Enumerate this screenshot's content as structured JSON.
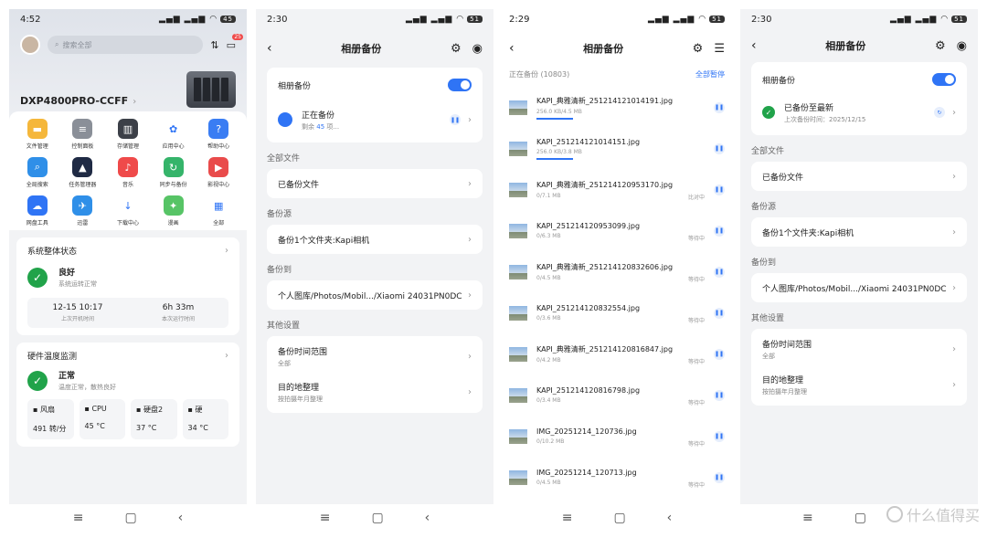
{
  "p1": {
    "time": "4:52",
    "battery": "45",
    "search_placeholder": "搜索全部",
    "badge": "25",
    "device": "DXP4800PRO-CCFF",
    "apps": [
      {
        "label": "文件管理",
        "color": "#f5b73b",
        "glyph": "▬"
      },
      {
        "label": "控制面板",
        "color": "#8a8f98",
        "glyph": "≡"
      },
      {
        "label": "存储管理",
        "color": "#3c4048",
        "glyph": "▥"
      },
      {
        "label": "应用中心",
        "color": "#ffffff",
        "glyph": "✿"
      },
      {
        "label": "帮助中心",
        "color": "#3a7df3",
        "glyph": "?"
      },
      {
        "label": "全局搜索",
        "color": "#2f8fe8",
        "glyph": "⌕"
      },
      {
        "label": "任务管理器",
        "color": "#1f2a44",
        "glyph": "▲"
      },
      {
        "label": "音乐",
        "color": "#ef4a4a",
        "glyph": "♪"
      },
      {
        "label": "同步与备份",
        "color": "#35b46a",
        "glyph": "↻"
      },
      {
        "label": "影视中心",
        "color": "#e94b4b",
        "glyph": "▶"
      },
      {
        "label": "网盘工具",
        "color": "#2f74f5",
        "glyph": "☁"
      },
      {
        "label": "迅雷",
        "color": "#2f8fe8",
        "glyph": "✈"
      },
      {
        "label": "下载中心",
        "color": "#ffffff",
        "glyph": "↓"
      },
      {
        "label": "漫画",
        "color": "#57c466",
        "glyph": "✦"
      },
      {
        "label": "全部",
        "color": "#ffffff",
        "glyph": "▦"
      }
    ],
    "status_card": {
      "title": "系统整体状态",
      "state": "良好",
      "desc": "系统运转正常",
      "boot_time": "12-15 10:17",
      "boot_label": "上次开机时间",
      "uptime": "6h 33m",
      "uptime_label": "本次运行时间"
    },
    "temp_card": {
      "title": "硬件温度监测",
      "state": "正常",
      "desc": "温度正常，散热良好",
      "sensors": [
        {
          "name": "风扇",
          "value": "491 转/分"
        },
        {
          "name": "CPU",
          "value": "45 °C"
        },
        {
          "name": "硬盘2",
          "value": "37 °C"
        },
        {
          "name": "硬",
          "value": "34 °C"
        }
      ]
    }
  },
  "p2": {
    "time": "2:30",
    "battery": "51",
    "title": "相册备份",
    "album_backup": "相册备份",
    "backing_up": "正在备份",
    "remaining_prefix": "剩余",
    "remaining_count": "45",
    "remaining_suffix": "项...",
    "sec_all": "全部文件",
    "backed_files": "已备份文件",
    "sec_source": "备份源",
    "source": "备份1个文件夹:Kapi相机",
    "sec_dest": "备份到",
    "dest": "个人图库/Photos/Mobil.../Xiaomi 24031PN0DC",
    "sec_other": "其他设置",
    "range": "备份时间范围",
    "range_sub": "全部",
    "organize": "目的地整理",
    "organize_sub": "按拍摄年月整理"
  },
  "p3": {
    "time": "2:29",
    "battery": "51",
    "title": "相册备份",
    "listing": "正在备份 (10803)",
    "pause_all": "全部暂停",
    "items": [
      {
        "name": "KAPI_典雅清新_251214121014191.jpg",
        "size": "256.0 KB/4.5 MB",
        "state": "",
        "bar": true
      },
      {
        "name": "KAPI_251214121014151.jpg",
        "size": "256.0 KB/3.8 MB",
        "state": "",
        "bar": true
      },
      {
        "name": "KAPI_典雅清新_251214120953170.jpg",
        "size": "0/7.1 MB",
        "state": "比对中",
        "bar": false
      },
      {
        "name": "KAPI_251214120953099.jpg",
        "size": "0/6.3 MB",
        "state": "等待中",
        "bar": false
      },
      {
        "name": "KAPI_典雅清新_251214120832606.jpg",
        "size": "0/4.5 MB",
        "state": "等待中",
        "bar": false
      },
      {
        "name": "KAPI_251214120832554.jpg",
        "size": "0/3.6 MB",
        "state": "等待中",
        "bar": false
      },
      {
        "name": "KAPI_典雅清新_251214120816847.jpg",
        "size": "0/4.2 MB",
        "state": "等待中",
        "bar": false
      },
      {
        "name": "KAPI_251214120816798.jpg",
        "size": "0/3.4 MB",
        "state": "等待中",
        "bar": false
      },
      {
        "name": "IMG_20251214_120736.jpg",
        "size": "0/10.2 MB",
        "state": "等待中",
        "bar": false
      },
      {
        "name": "IMG_20251214_120713.jpg",
        "size": "0/4.5 MB",
        "state": "等待中",
        "bar": false
      }
    ]
  },
  "p4": {
    "time": "2:30",
    "battery": "51",
    "title": "相册备份",
    "album_backup": "相册备份",
    "done": "已备份至最新",
    "last_time": "上次备份时间：2025/12/15",
    "sec_all": "全部文件",
    "backed_files": "已备份文件",
    "sec_source": "备份源",
    "source": "备份1个文件夹:Kapi相机",
    "sec_dest": "备份到",
    "dest": "个人图库/Photos/Mobil.../Xiaomi 24031PN0DC",
    "sec_other": "其他设置",
    "range": "备份时间范围",
    "range_sub": "全部",
    "organize": "目的地整理",
    "organize_sub": "按拍摄年月整理"
  },
  "nav": {
    "menu": "≡",
    "home": "▢",
    "back": "‹"
  },
  "watermark": "什么值得买"
}
